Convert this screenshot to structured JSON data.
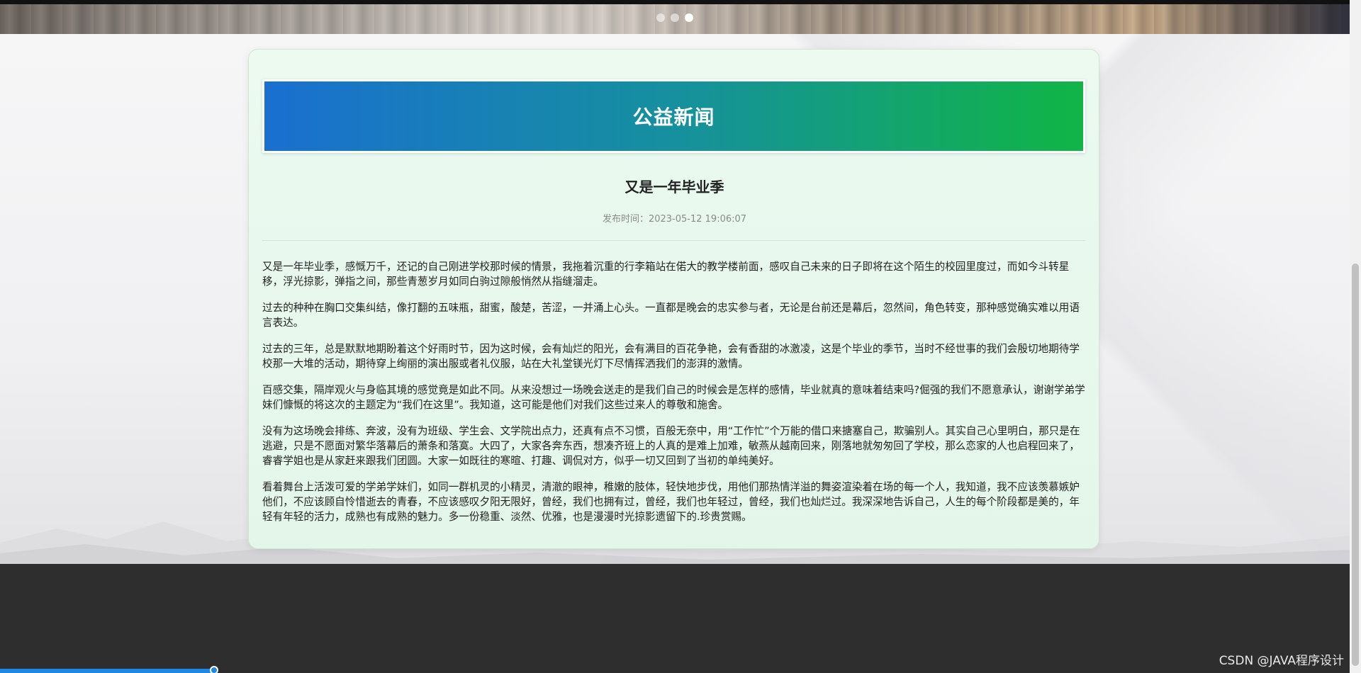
{
  "carousel": {
    "dots": [
      {
        "active": false
      },
      {
        "active": false
      },
      {
        "active": true
      }
    ]
  },
  "card": {
    "header_title": "公益新闻",
    "article_title": "又是一年毕业季",
    "publish_label": "发布时间：",
    "publish_time": "2023-05-12 19:06:07",
    "paragraphs": [
      "又是一年毕业季，感慨万千，还记的自己刚进学校那时候的情景，我拖着沉重的行李箱站在偌大的教学楼前面，感叹自己未来的日子即将在这个陌生的校园里度过，而如今斗转星移，浮光掠影，弹指之间，那些青葱岁月如同白驹过隙般悄然从指缝溜走。",
      "过去的种种在胸口交集纠结，像打翻的五味瓶，甜蜜，酸楚，苦涩，一并涌上心头。一直都是晚会的忠实参与者，无论是台前还是幕后，忽然间，角色转变，那种感觉确实难以用语言表达。",
      "过去的三年，总是默默地期盼着这个好雨时节，因为这时候，会有灿烂的阳光，会有满目的百花争艳，会有香甜的冰激凌，这是个毕业的季节，当时不经世事的我们会殷切地期待学校那一大堆的活动，期待穿上绚丽的演出服或者礼仪服，站在大礼堂镁光灯下尽情挥洒我们的澎湃的激情。",
      "百感交集，隔岸观火与身临其境的感觉竟是如此不同。从来没想过一场晚会送走的是我们自己的时候会是怎样的感情，毕业就真的意味着结束吗?倔强的我们不愿意承认，谢谢学弟学妹们慷慨的将这次的主题定为“我们在这里”。我知道，这可能是他们对我们这些过来人的尊敬和施舍。",
      "没有为这场晚会排练、奔波，没有为班级、学生会、文学院出点力，还真有点不习惯，百般无奈中，用“工作忙”个万能的借口来搪塞自己，欺骗别人。其实自己心里明白，那只是在逃避，只是不愿面对繁华落幕后的萧条和落寞。大四了，大家各奔东西，想凑齐班上的人真的是难上加难，敏燕从越南回来，刚落地就匆匆回了学校，那么恋家的人也启程回来了，睿睿学姐也是从家赶来跟我们团圆。大家一如既往的寒暄、打趣、调侃对方，似乎一切又回到了当初的单纯美好。",
      "看着舞台上活泼可爱的学弟学妹们，如同一群机灵的小精灵，清澈的眼神，稚嫩的肢体，轻快地步伐，用他们那热情洋溢的舞姿渲染着在场的每一个人，我知道，我不应该羡慕嫉妒他们，不应该顾自怜惜逝去的青春，不应该感叹夕阳无限好，曾经，我们也拥有过，曾经，我们也年轻过，曾经，我们也灿烂过。我深深地告诉自己，人生的每个阶段都是美的，年轻有年轻的活力，成熟也有成熟的魅力。多一份稳重、淡然、优雅，也是漫漫时光掠影遗留下的.珍贵赏赐。"
    ]
  },
  "watermark": "CSDN @JAVA程序设计"
}
